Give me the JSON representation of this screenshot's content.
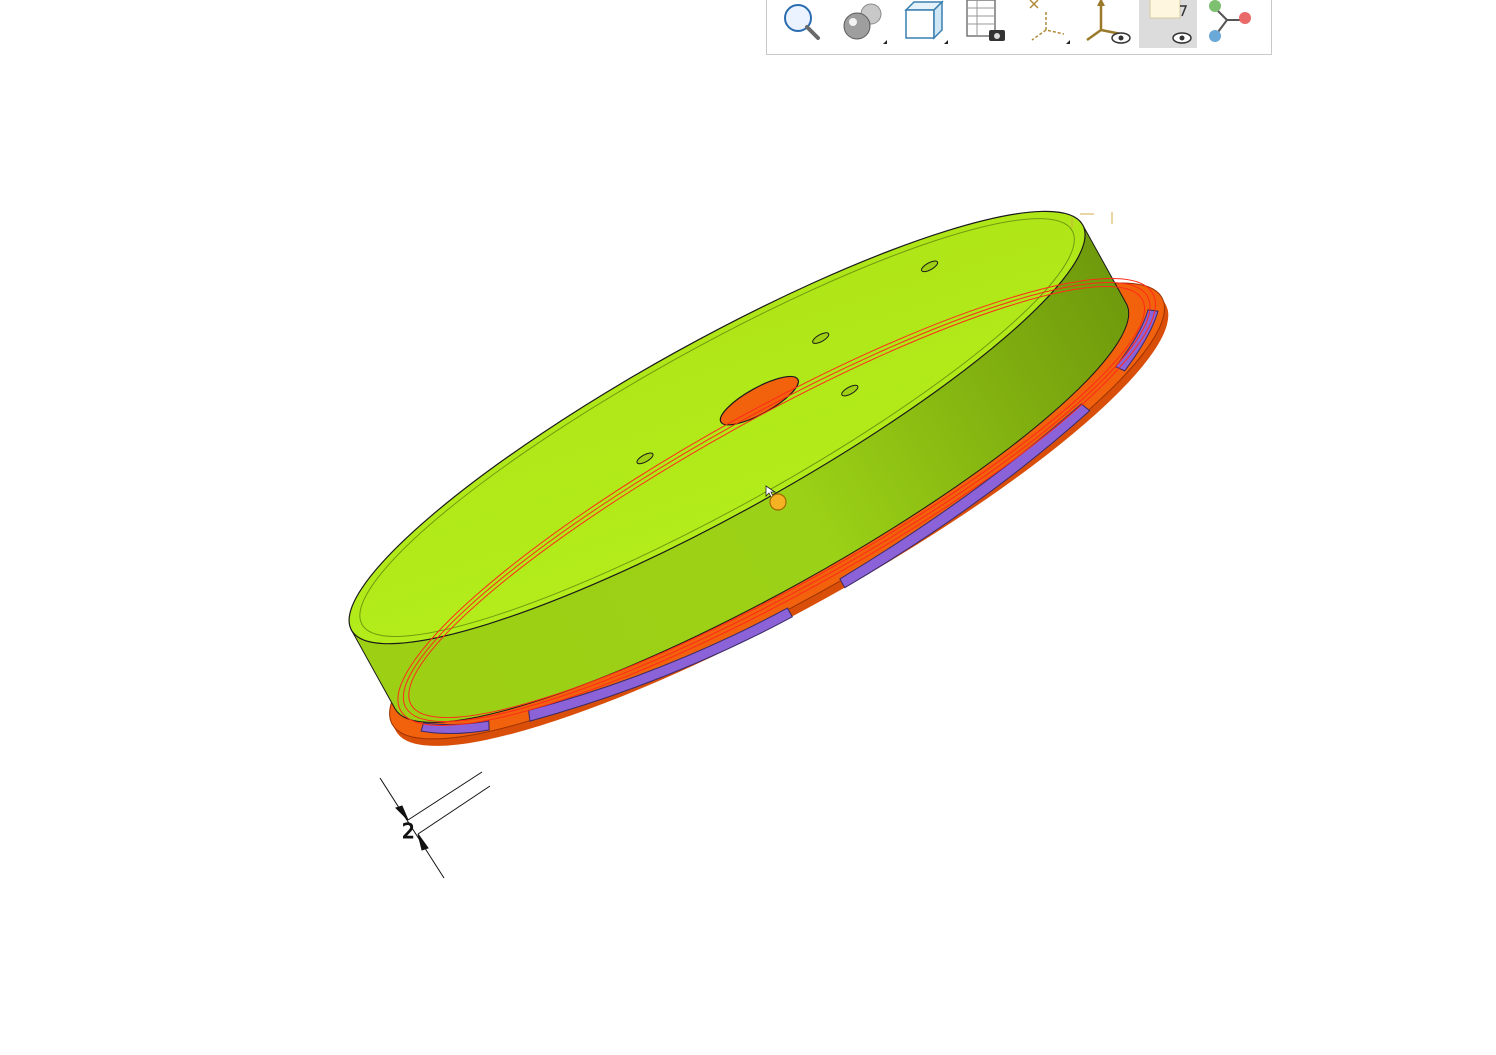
{
  "viewport": {
    "model_colors": {
      "top_face": "#b2ec18",
      "side_face": "#8fc012",
      "flange": "#f2610c",
      "slots": "#8c62d8",
      "edges": "#1a1a1a",
      "selection": "#ff2a1a"
    },
    "dimension": {
      "value": "2"
    }
  },
  "toolbar": {
    "buttons": [
      {
        "icon": "zoom-magnifier-icon",
        "active": false
      },
      {
        "icon": "shading-spheres-icon",
        "active": false
      },
      {
        "icon": "cube-view-icon",
        "active": false
      },
      {
        "icon": "sheet-camera-icon",
        "active": false
      },
      {
        "icon": "coordinate-systems-icon",
        "active": false
      },
      {
        "icon": "axis-visibility-icon",
        "active": false
      },
      {
        "icon": "plane-visibility-icon",
        "active": true
      },
      {
        "icon": "connector-nodes-icon",
        "active": false
      }
    ]
  }
}
